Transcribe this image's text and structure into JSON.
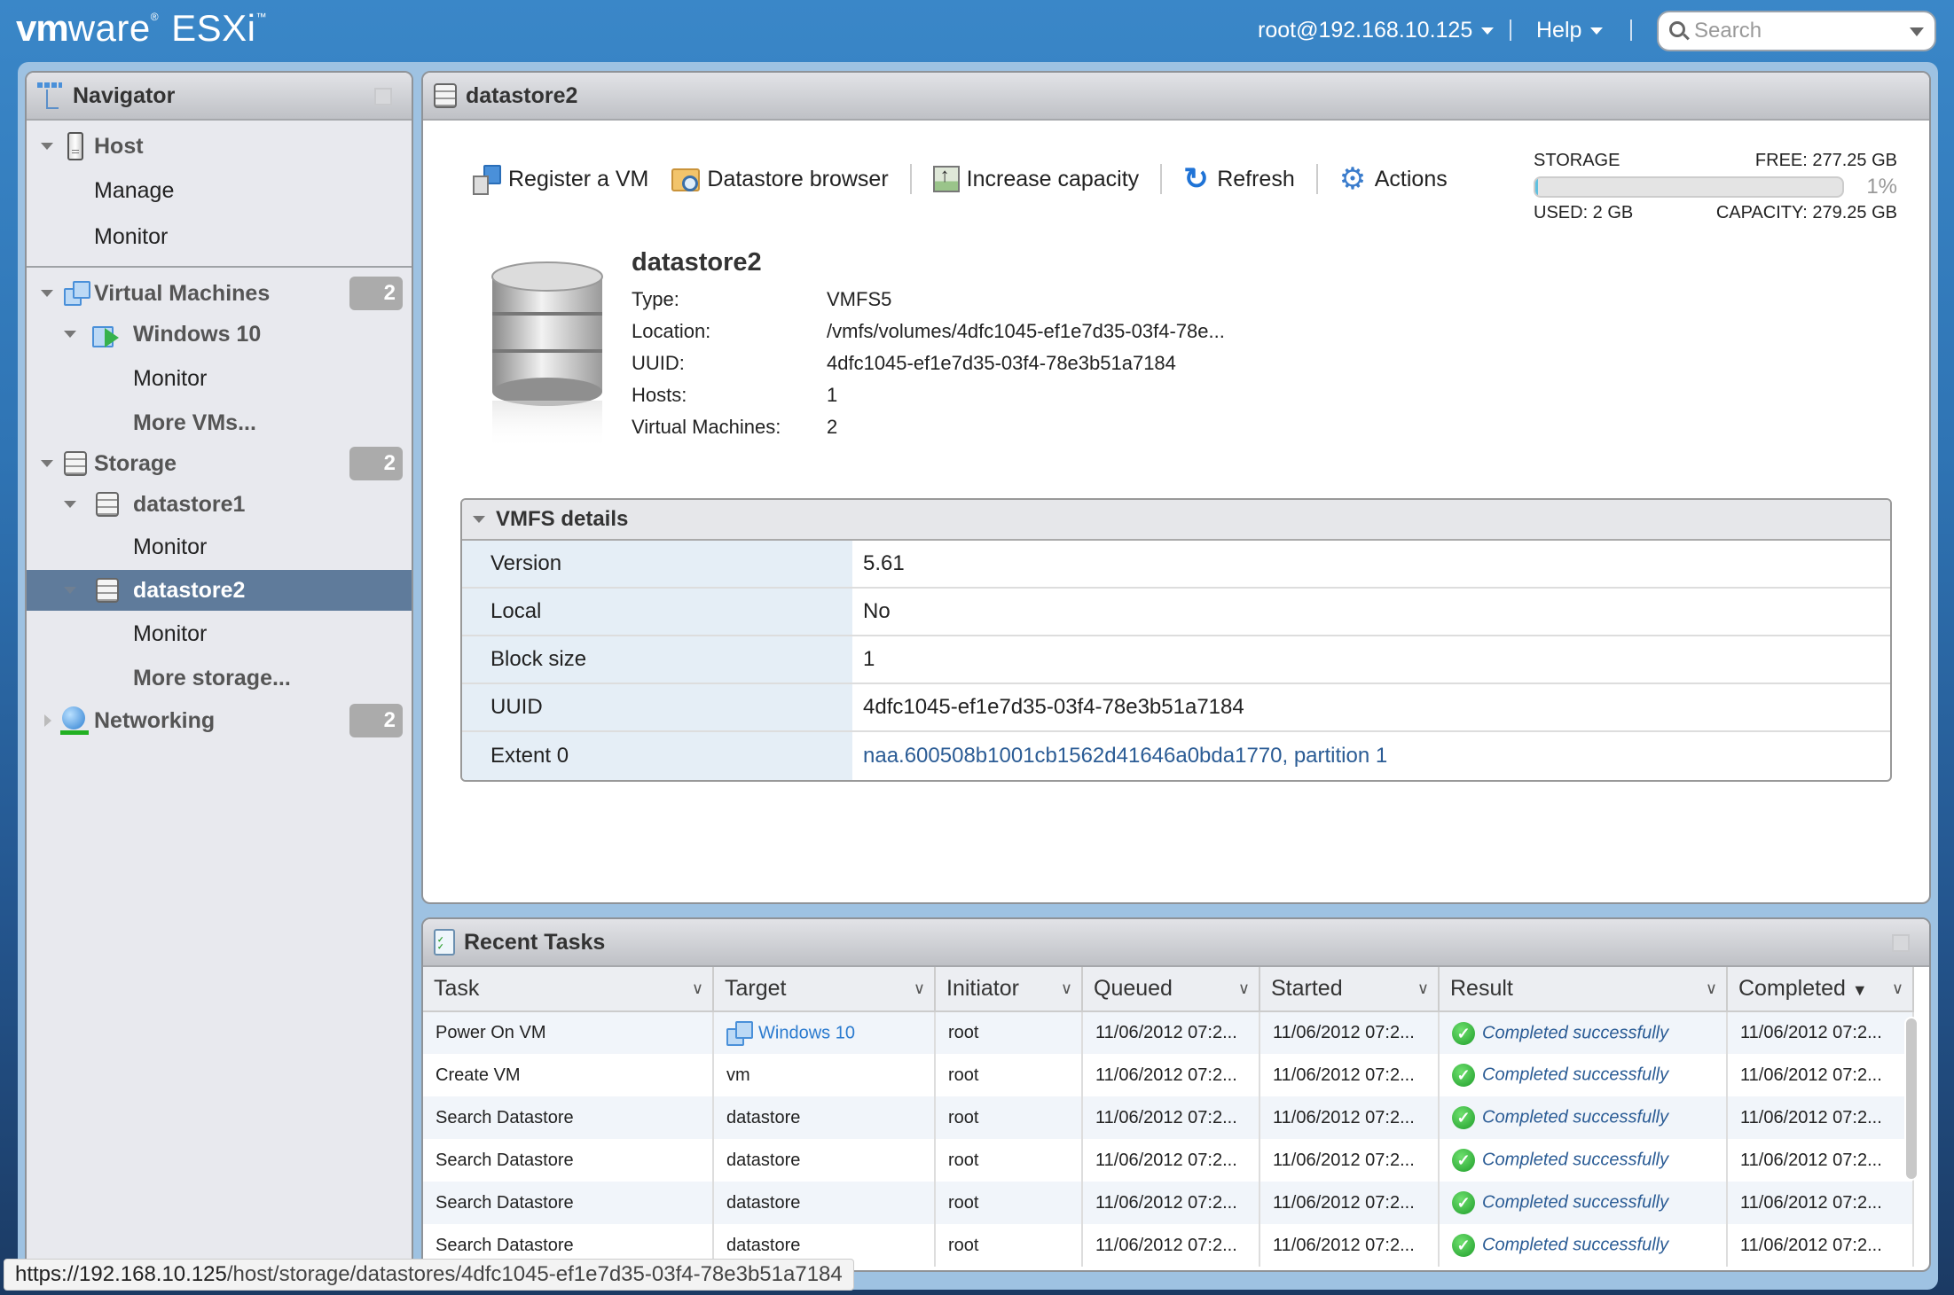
{
  "header": {
    "logo_vm": "vm",
    "logo_ware": "ware",
    "logo_product": "ESXi",
    "user": "root@192.168.10.125",
    "help": "Help",
    "search_placeholder": "Search"
  },
  "navigator": {
    "title": "Navigator",
    "items": [
      {
        "label": "Host",
        "icon": "host-icon"
      },
      {
        "label": "Manage"
      },
      {
        "label": "Monitor"
      },
      {
        "label": "Virtual Machines",
        "icon": "virtual-machines-icon",
        "badge": "2"
      },
      {
        "label": "Windows 10",
        "icon": "vm-powered-on-icon"
      },
      {
        "label": "Monitor"
      },
      {
        "label": "More VMs..."
      },
      {
        "label": "Storage",
        "icon": "datastore-icon",
        "badge": "2"
      },
      {
        "label": "datastore1",
        "icon": "datastore-icon"
      },
      {
        "label": "Monitor"
      },
      {
        "label": "datastore2",
        "icon": "datastore-icon",
        "selected": true
      },
      {
        "label": "Monitor"
      },
      {
        "label": "More storage..."
      },
      {
        "label": "Networking",
        "icon": "network-globe-icon",
        "badge": "2"
      }
    ]
  },
  "main": {
    "title": "datastore2",
    "toolbar": {
      "register_vm": "Register a VM",
      "datastore_browser": "Datastore browser",
      "increase_capacity": "Increase capacity",
      "refresh": "Refresh",
      "actions": "Actions"
    },
    "storage": {
      "label": "STORAGE",
      "free": "FREE: 277.25 GB",
      "percent": "1%",
      "used_fraction": 0.01,
      "used": "USED: 2 GB",
      "capacity": "CAPACITY: 279.25 GB"
    },
    "datastore": {
      "name": "datastore2",
      "props": [
        {
          "key": "Type:",
          "value": "VMFS5"
        },
        {
          "key": "Location:",
          "value": "/vmfs/volumes/4dfc1045-ef1e7d35-03f4-78e..."
        },
        {
          "key": "UUID:",
          "value": "4dfc1045-ef1e7d35-03f4-78e3b51a7184"
        },
        {
          "key": "Hosts:",
          "value": "1"
        },
        {
          "key": "Virtual Machines:",
          "value": "2"
        }
      ]
    },
    "vmfs": {
      "title": "VMFS details",
      "rows": [
        {
          "key": "Version",
          "value": "5.61"
        },
        {
          "key": "Local",
          "value": "No"
        },
        {
          "key": "Block size",
          "value": "1"
        },
        {
          "key": "UUID",
          "value": "4dfc1045-ef1e7d35-03f4-78e3b51a7184"
        },
        {
          "key": "Extent 0",
          "value": "naa.600508b1001cb1562d41646a0bda1770, partition 1"
        }
      ]
    }
  },
  "tasks": {
    "title": "Recent Tasks",
    "columns": [
      "Task",
      "Target",
      "Initiator",
      "Queued",
      "Started",
      "Result",
      "Completed"
    ],
    "sorted_column": "Completed",
    "rows": [
      {
        "task": "Power On VM",
        "target": "Windows 10",
        "initiator": "root",
        "queued": "11/06/2012 07:2...",
        "started": "11/06/2012 07:2...",
        "result": "Completed successfully",
        "completed": "11/06/2012 07:2..."
      },
      {
        "task": "Create VM",
        "target": "vm",
        "initiator": "root",
        "queued": "11/06/2012 07:2...",
        "started": "11/06/2012 07:2...",
        "result": "Completed successfully",
        "completed": "11/06/2012 07:2..."
      },
      {
        "task": "Search Datastore",
        "target": "datastore",
        "initiator": "root",
        "queued": "11/06/2012 07:2...",
        "started": "11/06/2012 07:2...",
        "result": "Completed successfully",
        "completed": "11/06/2012 07:2..."
      },
      {
        "task": "Search Datastore",
        "target": "datastore",
        "initiator": "root",
        "queued": "11/06/2012 07:2...",
        "started": "11/06/2012 07:2...",
        "result": "Completed successfully",
        "completed": "11/06/2012 07:2..."
      },
      {
        "task": "Search Datastore",
        "target": "datastore",
        "initiator": "root",
        "queued": "11/06/2012 07:2...",
        "started": "11/06/2012 07:2...",
        "result": "Completed successfully",
        "completed": "11/06/2012 07:2..."
      },
      {
        "task": "Search Datastore",
        "target": "datastore",
        "initiator": "root",
        "queued": "11/06/2012 07:2...",
        "started": "11/06/2012 07:2...",
        "result": "Completed successfully",
        "completed": "11/06/2012 07:2..."
      }
    ]
  },
  "status_bar": {
    "url_host": "https://192.168.10.125",
    "url_path": "/host/storage/datastores/4dfc1045-ef1e7d35-03f4-78e3b51a7184"
  }
}
